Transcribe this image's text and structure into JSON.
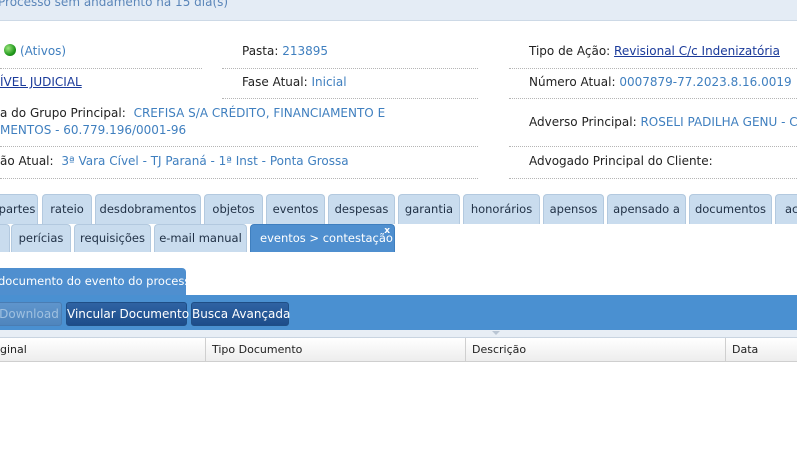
{
  "topbar": {
    "message": "Processo sem andamento há 15 dia(s)"
  },
  "info": {
    "status_value": "(Ativos)",
    "pasta_label": "Pasta:",
    "pasta_value": "213895",
    "tipo_acao_label": "Tipo de Ação:",
    "tipo_acao_value": "Revisional C/c Indenizatória",
    "area_value": "ÍVEL JUDICIAL",
    "fase_label": "Fase Atual:",
    "fase_value": "Inicial",
    "numero_label": "Número Atual:",
    "numero_value": "0007879-77.2023.8.16.0019",
    "grupo_label": "a do Grupo Principal:",
    "grupo_value_1": "CREFISA S/A CRÉDITO, FINANCIAMENTO E",
    "grupo_value_2": "MENTOS - 60.779.196/0001-96",
    "adverso_label": "Adverso Principal:",
    "adverso_value": "ROSELI PADILHA GENU - C",
    "orgao_label": "ão Atual:",
    "orgao_value": "3ª Vara Cível - TJ Paraná - 1ª Inst - Ponta Grossa",
    "advogado_label": "Advogado Principal do Cliente:"
  },
  "tabs_row1": [
    "partes",
    "rateio",
    "desdobramentos",
    "objetos",
    "eventos",
    "despesas",
    "garantia",
    "honorários",
    "apensos",
    "apensado a",
    "documentos",
    "ac"
  ],
  "tabs_row2": [
    "",
    "perícias",
    "requisições",
    "e-mail manual",
    "eventos > contestação"
  ],
  "tab_close_glyph": "x",
  "subtab": {
    "label": "documento do evento do processo"
  },
  "toolbar": {
    "download": "Download",
    "vincular": "Vincular Documento",
    "busca": "Busca Avançada"
  },
  "grid": {
    "columns": [
      "ginal",
      "Tipo Documento",
      "Descrição",
      "Data"
    ]
  },
  "colors": {
    "accent": "#4f8fcf",
    "link": "#3f7fbf",
    "tab": "#c9dcee"
  }
}
